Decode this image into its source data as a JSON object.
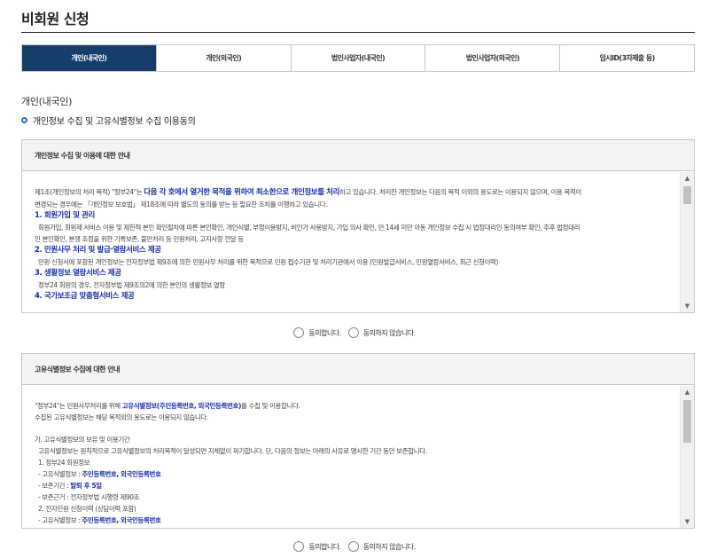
{
  "page": {
    "title": "비회원 신청"
  },
  "tabs": [
    {
      "label": "개인(내국인)",
      "active": true
    },
    {
      "label": "개인(외국인)",
      "active": false
    },
    {
      "label": "법인사업자(내국인)",
      "active": false
    },
    {
      "label": "법인사업자(외국인)",
      "active": false
    },
    {
      "label": "임시ID(3자제출 등)",
      "active": false
    }
  ],
  "section": {
    "heading": "개인(내국인)",
    "subheading": "개인정보 수집 및 고유식별정보 수집 이용동의"
  },
  "privacy_box": {
    "title": "개인정보 수집 및 이용에 대한 안내",
    "intro_a": "제1조(개인정보의 처리 목적) \"정부24\"는 ",
    "intro_b": "다음 각 호에서 열거한 목적을 위하여 최소한으로 개인정보를 처리",
    "intro_c": "하고 있습니다. 처리한 개인정보는 다음의 목적 이외의 용도로는 이용되지 않으며, 이용 목적이",
    "intro_line2": "변경되는 경우에는 「개인정보 보호법」 제18조에 따라 별도의 동의를 받는 등 필요한 조치를 이행하고 있습니다.",
    "h1": "1. 회원가입 및 관리",
    "p1a": "회원가입, 회원제 서비스 이용 및 제한적 본인 확인절차에 따른 본인확인, 개인식별, 부정이용방지, 비인가 사용방지, 가입 의사 확인, 만 14세 미만 아동 개인정보 수집 시 법정대리인 동의여부 확인, 추후 법정대리",
    "p1b": "인 본인확인, 분쟁 조정을 위한 기록보존, 불만처리 등 민원처리, 고지사항 전달 등",
    "h2": "2. 민원사무 처리 및 발급·열람서비스 제공",
    "p2": "민원 신청서에 포함된 개인정보는 전자정부법 제9조에 의한 민원사무 처리를 위한 목적으로 민원 접수기관 및 처리기관에서 이용 (민원발급서비스, 민원열람서비스, 최근 신청이력)",
    "h3": "3. 생활정보 열람서비스 제공",
    "p3": "정부24 회원의 경우, 전자정부법 제9조의2에 의한 본인의 생활정보 열람",
    "h4": "4. 국가보조금 맞춤형서비스 제공"
  },
  "unique_box": {
    "title": "고유식별정보 수집에 대한 안내",
    "l1a": "\"정부24\"는 민원사무처리를 위해 ",
    "l1b": "고유식별정보(주민등록번호, 외국인등록번호)",
    "l1c": "를 수집 및 이용합니다.",
    "l2": "수집된 고유식별정보는 해당 목적외의 용도로는 이용되지 않습니다.",
    "l3": "가. 고유식별정보의 보유 및 이용기간",
    "l4": "고유식별정보는 원칙적으로 고유식별정보의 처리목적이 달성되면 지체없이 파기합니다. 단, 다음의 정보는 아래의 사유로 명시한 기간 동안 보존합니다.",
    "l5": "1. 정부24 회원정보",
    "l6a": "- 고유식별정보 : ",
    "l6b": "주민등록번호, 외국인등록번호",
    "l7a": "- 보존기간 : ",
    "l7b": "탈퇴 후 5일",
    "l8": "- 보존근거 : 전자정부법 시행령 제90조",
    "l9": "2. 전자민원 신청이력 (상담이력 포함)",
    "l10a": "- 고유식별정보 : ",
    "l10b": "주민등록번호, 외국인등록번호"
  },
  "consent": {
    "agree": "동의합니다.",
    "disagree": "동의하지 않습니다."
  }
}
